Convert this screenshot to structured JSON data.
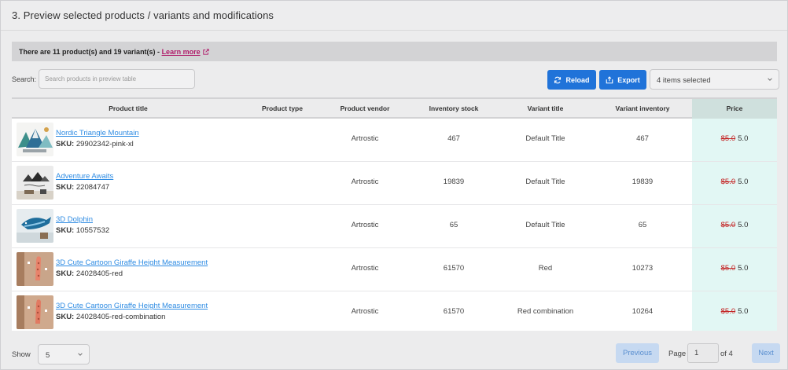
{
  "section": {
    "title": "3. Preview selected products / variants and modifications"
  },
  "notice": {
    "text": "There are 11 product(s) and 19 variant(s) - ",
    "link_label": "Learn more",
    "link_color": "#b01b6a"
  },
  "search": {
    "label": "Search:",
    "placeholder": "Search products in preview table",
    "value": ""
  },
  "toolbar": {
    "reload_label": "Reload",
    "export_label": "Export",
    "selected_label": "4 items selected",
    "accent": "#2073d9"
  },
  "table": {
    "columns": [
      "Product title",
      "Product type",
      "Product vendor",
      "Inventory stock",
      "Variant title",
      "Variant inventory",
      "Price"
    ],
    "rows": [
      {
        "title": "Nordic Triangle Mountain",
        "sku_label": "SKU:",
        "sku": "29902342-pink-xl",
        "type": "",
        "vendor": "Artrostic",
        "stock": "467",
        "variant_title": "Default Title",
        "variant_inventory": "467",
        "old_price": "$5.0",
        "price": "5.0",
        "thumb": "mountain"
      },
      {
        "title": "Adventure Awaits",
        "sku_label": "SKU:",
        "sku": "22084747",
        "type": "",
        "vendor": "Artrostic",
        "stock": "19839",
        "variant_title": "Default Title",
        "variant_inventory": "19839",
        "old_price": "$5.0",
        "price": "5.0",
        "thumb": "wall-decal"
      },
      {
        "title": "3D Dolphin",
        "sku_label": "SKU:",
        "sku": "10557532",
        "type": "",
        "vendor": "Artrostic",
        "stock": "65",
        "variant_title": "Default Title",
        "variant_inventory": "65",
        "old_price": "$5.0",
        "price": "5.0",
        "thumb": "dolphin"
      },
      {
        "title": "3D Cute Cartoon Giraffe Height Measurement",
        "sku_label": "SKU:",
        "sku": "24028405-red",
        "type": "",
        "vendor": "Artrostic",
        "stock": "61570",
        "variant_title": "Red",
        "variant_inventory": "10273",
        "old_price": "$5.0",
        "price": "5.0",
        "thumb": "giraffe"
      },
      {
        "title": "3D Cute Cartoon Giraffe Height Measurement",
        "sku_label": "SKU:",
        "sku": "24028405-red-combination",
        "type": "",
        "vendor": "Artrostic",
        "stock": "61570",
        "variant_title": "Red combination",
        "variant_inventory": "10264",
        "old_price": "$5.0",
        "price": "5.0",
        "thumb": "giraffe"
      }
    ]
  },
  "pagination": {
    "show_label": "Show",
    "page_size": "5",
    "prev_label": "Previous",
    "page_label": "Page",
    "current_page": "1",
    "of_label": "of 4",
    "next_label": "Next"
  },
  "colors": {
    "price_highlight": "#e2f7f4",
    "strike_price": "#c42424",
    "link": "#2f8ce3"
  }
}
